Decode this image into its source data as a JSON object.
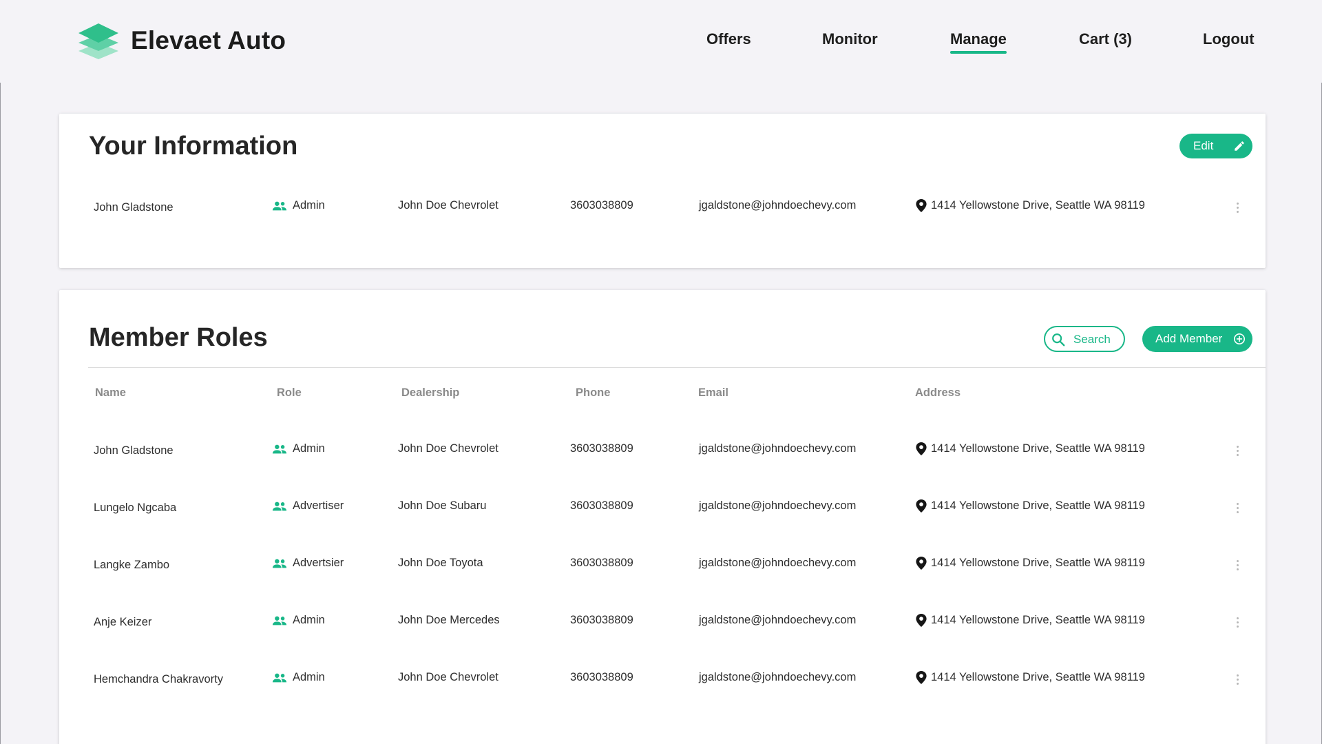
{
  "brand": {
    "name": "Elevaet Auto",
    "logo_icon": "stacked-layers-logo",
    "accent": "#19b788"
  },
  "nav": {
    "items": [
      {
        "label": "Offers",
        "active": false
      },
      {
        "label": "Monitor",
        "active": false
      },
      {
        "label": "Manage",
        "active": true
      },
      {
        "label": "Cart (3)",
        "active": false
      },
      {
        "label": "Logout",
        "active": false
      }
    ]
  },
  "info": {
    "title": "Your Information",
    "edit_label": "Edit",
    "edit_icon": "pencil-icon",
    "row": {
      "name": "John Gladstone",
      "role": "Admin",
      "dealership": "John Doe Chevrolet",
      "phone": "3603038809",
      "email": "jgaldstone@johndoechevy.com",
      "address": "1414 Yellowstone Drive, Seattle WA 98119"
    }
  },
  "roles": {
    "title": "Member Roles",
    "search_label": "Search",
    "add_label": "Add Member",
    "columns": {
      "name": "Name",
      "role": "Role",
      "dealership": "Dealership",
      "phone": "Phone",
      "email": "Email",
      "address": "Address"
    },
    "rows": [
      {
        "name": "John Gladstone",
        "role": "Admin",
        "dealership": "John Doe Chevrolet",
        "phone": "3603038809",
        "email": "jgaldstone@johndoechevy.com",
        "address": "1414 Yellowstone Drive, Seattle WA 98119"
      },
      {
        "name": "Lungelo Ngcaba",
        "role": "Advertiser",
        "dealership": "John Doe Subaru",
        "phone": "3603038809",
        "email": "jgaldstone@johndoechevy.com",
        "address": "1414 Yellowstone Drive, Seattle WA 98119"
      },
      {
        "name": "Langke Zambo",
        "role": "Advertsier",
        "dealership": "John Doe Toyota",
        "phone": "3603038809",
        "email": "jgaldstone@johndoechevy.com",
        "address": "1414 Yellowstone Drive, Seattle WA 98119"
      },
      {
        "name": "Anje Keizer",
        "role": "Admin",
        "dealership": "John Doe Mercedes",
        "phone": "3603038809",
        "email": "jgaldstone@johndoechevy.com",
        "address": "1414 Yellowstone Drive, Seattle WA 98119"
      },
      {
        "name": "Hemchandra Chakravorty",
        "role": "Admin",
        "dealership": "John Doe Chevrolet",
        "phone": "3603038809",
        "email": "jgaldstone@johndoechevy.com",
        "address": "1414 Yellowstone Drive, Seattle WA 98119"
      }
    ]
  }
}
